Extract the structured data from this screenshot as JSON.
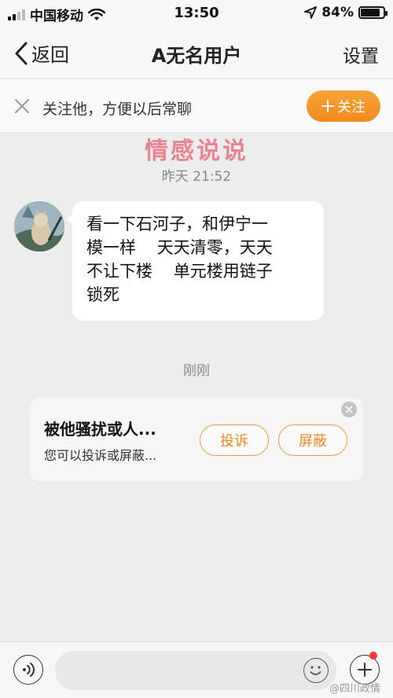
{
  "status_bar": {
    "carrier": "中国移动",
    "time": "13:50",
    "battery": "84%",
    "battery_level": 0.84
  },
  "nav": {
    "back_label": "返回",
    "title": "A无名用户",
    "settings_label": "设置"
  },
  "follow_bar": {
    "text": "关注他，方便以后常聊",
    "follow_label": "关注"
  },
  "watermark": "情感说说",
  "chat": {
    "timestamp_1": "昨天 21:52",
    "message_lines": [
      "看一下石河子，和伊宁一",
      "模一样    天天清零，天天",
      "不让下楼    单元楼用链子",
      "锁死"
    ],
    "timestamp_2": "刚刚"
  },
  "harass_card": {
    "title": "被他骚扰或人...",
    "subtitle": "您可以投诉或屏蔽...",
    "report_label": "投诉",
    "block_label": "屏蔽"
  },
  "input_bar": {
    "message_value": ""
  },
  "credit": "@四川政情",
  "colors": {
    "accent": "#f08a1d",
    "background": "#ededed",
    "badge": "#f2383a"
  },
  "icons": [
    "signal-icon",
    "wifi-icon",
    "location-icon",
    "battery-icon",
    "back-chevron-icon",
    "close-icon",
    "plus-icon",
    "voice-icon",
    "emoji-icon",
    "add-icon"
  ]
}
